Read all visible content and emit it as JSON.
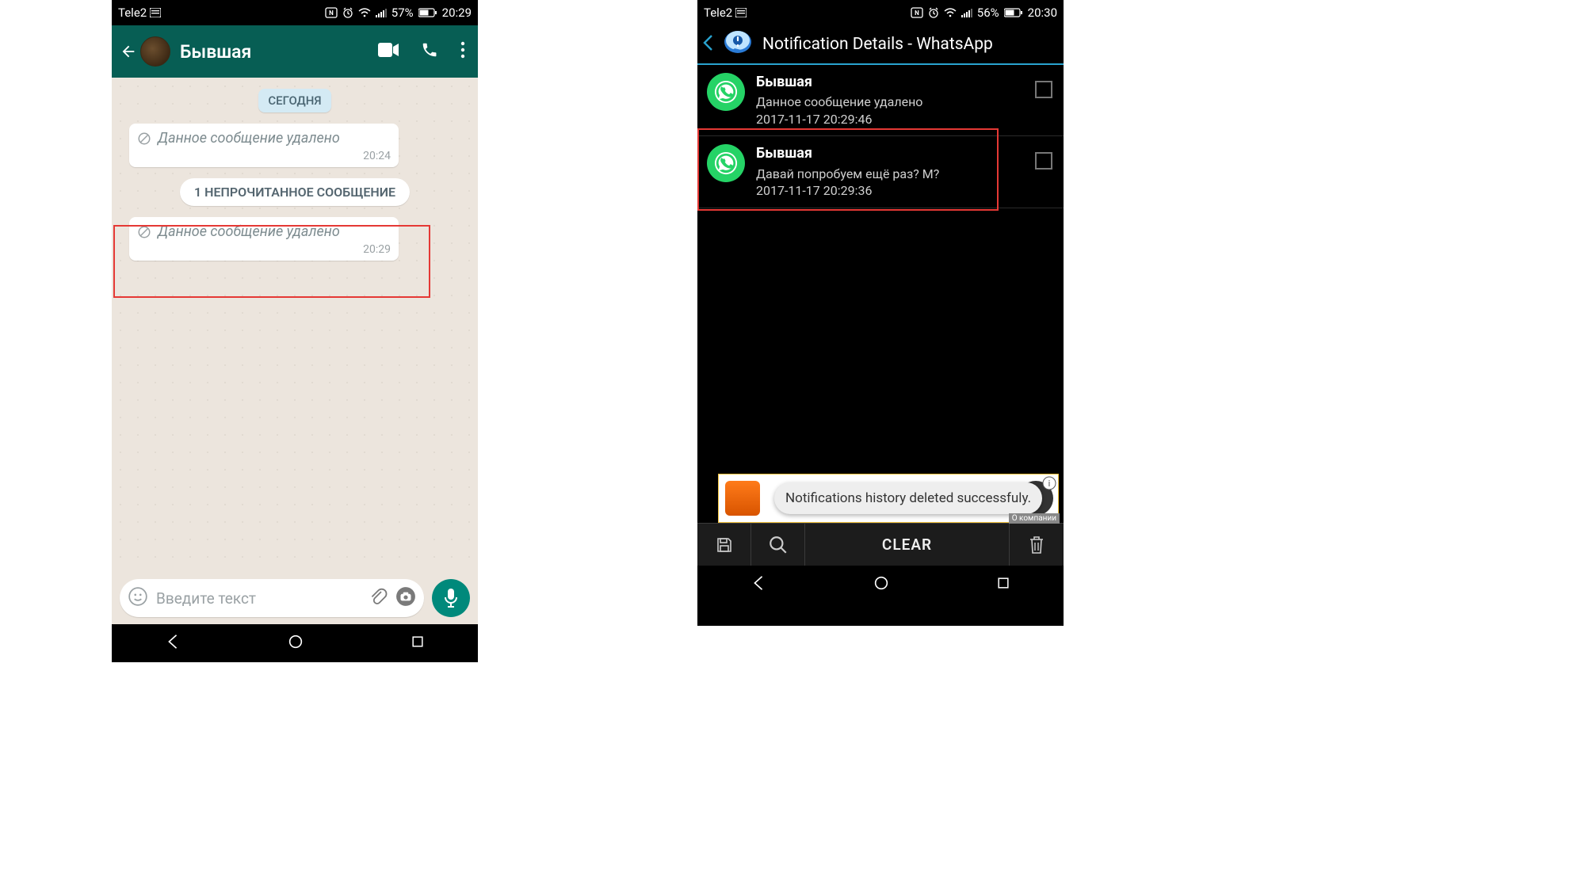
{
  "left": {
    "status": {
      "carrier": "Tele2",
      "battery": "57%",
      "time": "20:29"
    },
    "header": {
      "contact": "Бывшая"
    },
    "date_pill": "СЕГОДНЯ",
    "messages": [
      {
        "text": "Данное сообщение удалено",
        "time": "20:24"
      },
      {
        "text": "Данное сообщение удалено",
        "time": "20:29"
      }
    ],
    "unread": "1 НЕПРОЧИТАННОЕ СООБЩЕНИЕ",
    "composer": {
      "placeholder": "Введите текст"
    }
  },
  "right": {
    "status": {
      "carrier": "Tele2",
      "battery": "56%",
      "time": "20:30"
    },
    "header": {
      "title": "Notification Details - WhatsApp"
    },
    "rows": [
      {
        "sender": "Бывшая",
        "msg": "Данное сообщение удалено",
        "ts": "2017-11-17 20:29:46"
      },
      {
        "sender": "Бывшая",
        "msg": "Давай попробуем ещё раз? М?",
        "ts": "2017-11-17 20:29:36"
      }
    ],
    "toast": "Notifications history deleted successfuly.",
    "toolbar": {
      "clear": "CLEAR"
    },
    "ad": {
      "corner": "О компании"
    }
  }
}
